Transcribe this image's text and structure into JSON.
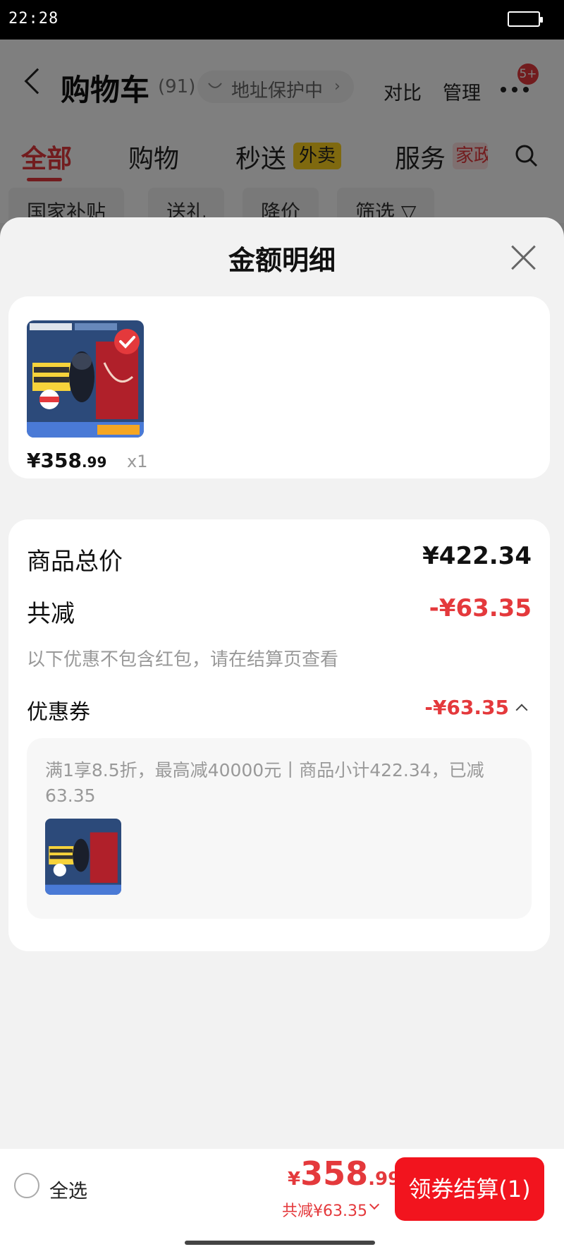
{
  "status": {
    "time": "22:28"
  },
  "cart": {
    "title": "购物车",
    "count": "(91)",
    "address": "地址保护中",
    "compare": "对比",
    "manage": "管理",
    "badge": "5+",
    "tabs": [
      "全部",
      "购物",
      "秒送",
      "服务"
    ],
    "tag_waimai": "外卖",
    "tag_jiazheng": "家政",
    "chips": [
      "国家补贴",
      "送礼",
      "降价",
      "筛选"
    ]
  },
  "sheet": {
    "title": "金额明细",
    "item": {
      "price_int": "¥358",
      "price_dec": ".99",
      "qty": "x1"
    },
    "total_label": "商品总价",
    "total_value": "¥422.34",
    "discount_label": "共减",
    "discount_value": "-¥63.35",
    "note": "以下优惠不包含红包，请在结算页查看",
    "coupon_label": "优惠券",
    "coupon_value": "-¥63.35",
    "coupon_desc": "满1享8.5折，最高减40000元丨商品小计422.34，已减63.35"
  },
  "bottom": {
    "select_all": "全选",
    "currency": "¥",
    "total_int": "358",
    "total_dec": ".99",
    "saved": "共减¥63.35",
    "checkout": "领券结算(1)"
  },
  "colors": {
    "accent": "#e4393c",
    "button": "#f2141e"
  }
}
